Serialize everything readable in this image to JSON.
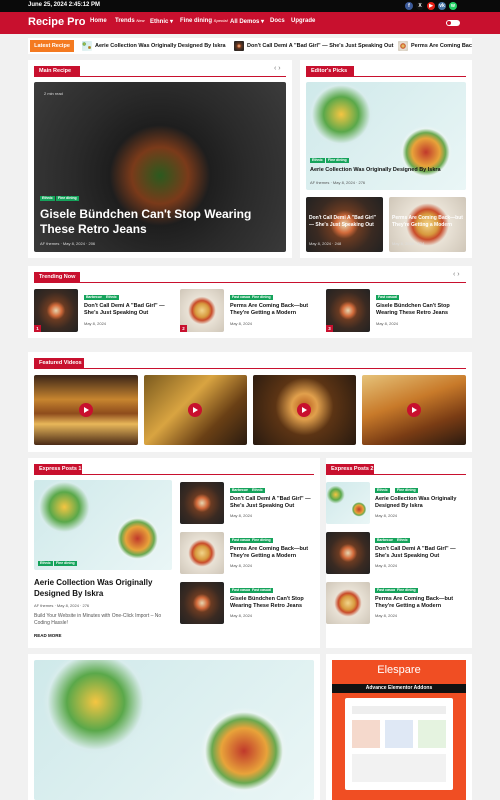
{
  "topbar": {
    "date": "June 25, 2024 2:45:12 PM",
    "social": [
      {
        "icon": "facebook-icon",
        "glyph": "f",
        "color": "#3b5998"
      },
      {
        "icon": "x-icon",
        "glyph": "X",
        "color": "#111111"
      },
      {
        "icon": "youtube-icon",
        "glyph": "▶",
        "color": "#e62117"
      },
      {
        "icon": "vk-icon",
        "glyph": "vk",
        "color": "#4a76a8"
      },
      {
        "icon": "whatsapp-icon",
        "glyph": "w",
        "color": "#25d366"
      }
    ]
  },
  "header": {
    "brand": "Recipe Pro",
    "nav": [
      {
        "label": "Home"
      },
      {
        "label": "Trends",
        "badge": "New"
      },
      {
        "label": "Ethnic"
      },
      {
        "label": "Fine dining",
        "badge": "Special"
      },
      {
        "label": "All Demos"
      },
      {
        "label": "Docs"
      },
      {
        "label": "Upgrade"
      }
    ]
  },
  "ticker": {
    "label": "Latest Recipe",
    "items": [
      "Aerie Collection Was Originally Designed By Iskra",
      "Don't Call Demi A \"Bad Girl\" — She's Just Speaking Out",
      "Perms Are Coming Back"
    ]
  },
  "main_recipe": {
    "section": "Main Recipe",
    "read_time": "2 min read",
    "cats": [
      "Ethnic",
      "Fine dining"
    ],
    "title": "Gisele Bündchen Can't Stop Wearing These Retro Jeans",
    "author": "AF themes",
    "date": "May 8, 2024",
    "views": "206"
  },
  "editors_picks": {
    "section": "Editor's Picks",
    "feature": {
      "cats": [
        "Ethnic",
        "Fine dining"
      ],
      "title": "Aerie Collection Was Originally Designed By Iskra",
      "author": "AF themes",
      "date": "May 8, 2024",
      "views": "276"
    },
    "small": [
      {
        "title": "Don't Call Demi A \"Bad Girl\" — She's Just Speaking Out",
        "date": "May 8, 2024",
        "views": "248"
      },
      {
        "title": "Perms Are Coming Back—but They're Getting a Modern",
        "date": "May 8, 2024",
        "views": "224"
      }
    ]
  },
  "trending": {
    "section": "Trending Now",
    "items": [
      {
        "num": "1",
        "cats": [
          "Barbecue",
          "Ethnic"
        ],
        "title": "Don't Call Demi A \"Bad Girl\" — She's Just Speaking Out",
        "date": "May 8, 2024"
      },
      {
        "num": "2",
        "cats": [
          "Fast casual",
          "Fine dining"
        ],
        "title": "Perms Are Coming Back—but They're Getting a Modern",
        "date": "May 8, 2024"
      },
      {
        "num": "3",
        "cats": [
          "Fast casual"
        ],
        "title": "Gisele Bündchen Can't Stop Wearing These Retro Jeans",
        "date": "May 8, 2024"
      }
    ]
  },
  "videos": {
    "section": "Featured Videos"
  },
  "express1": {
    "section": "Express Posts 1",
    "feature": {
      "cats": [
        "Ethnic",
        "Fine dining"
      ],
      "title": "Aerie Collection Was Originally Designed By Iskra",
      "author": "AF themes",
      "date": "May 8, 2024",
      "views": "276",
      "excerpt": "Build Your Website in Minutes with One-Click Import – No Coding Hassle!",
      "read_more": "READ MORE"
    },
    "list": [
      {
        "cats": [
          "Barbecue",
          "Ethnic"
        ],
        "title": "Don't Call Demi A \"Bad Girl\" — She's Just Speaking Out",
        "date": "May 8, 2024"
      },
      {
        "cats": [
          "Fast casual",
          "Fine dining"
        ],
        "title": "Perms Are Coming Back—but They're Getting a Modern",
        "date": "May 8, 2024"
      },
      {
        "cats": [
          "Fast casual",
          "Fast casual"
        ],
        "title": "Gisele Bündchen Can't Stop Wearing These Retro Jeans",
        "date": "May 8, 2024"
      }
    ]
  },
  "express2": {
    "section": "Express Posts 2",
    "list": [
      {
        "cats": [
          "Ethnic",
          "Fine dining"
        ],
        "title": "Aerie Collection Was Originally Designed By Iskra",
        "date": "May 8, 2024"
      },
      {
        "cats": [
          "Barbecue",
          "Ethnic"
        ],
        "title": "Don't Call Demi A \"Bad Girl\" — She's Just Speaking Out",
        "date": "May 8, 2024"
      },
      {
        "cats": [
          "Fast casual",
          "Fine dining"
        ],
        "title": "Perms Are Coming Back—but They're Getting a Modern",
        "date": "May 8, 2024"
      }
    ]
  },
  "ad": {
    "brand": "Elespare",
    "tagline": "Advance Elementor Addons"
  },
  "colors": {
    "accent": "#c8102e",
    "ticker_label": "#f47a20",
    "category": "#15a35b",
    "ad": "#f04e23"
  }
}
